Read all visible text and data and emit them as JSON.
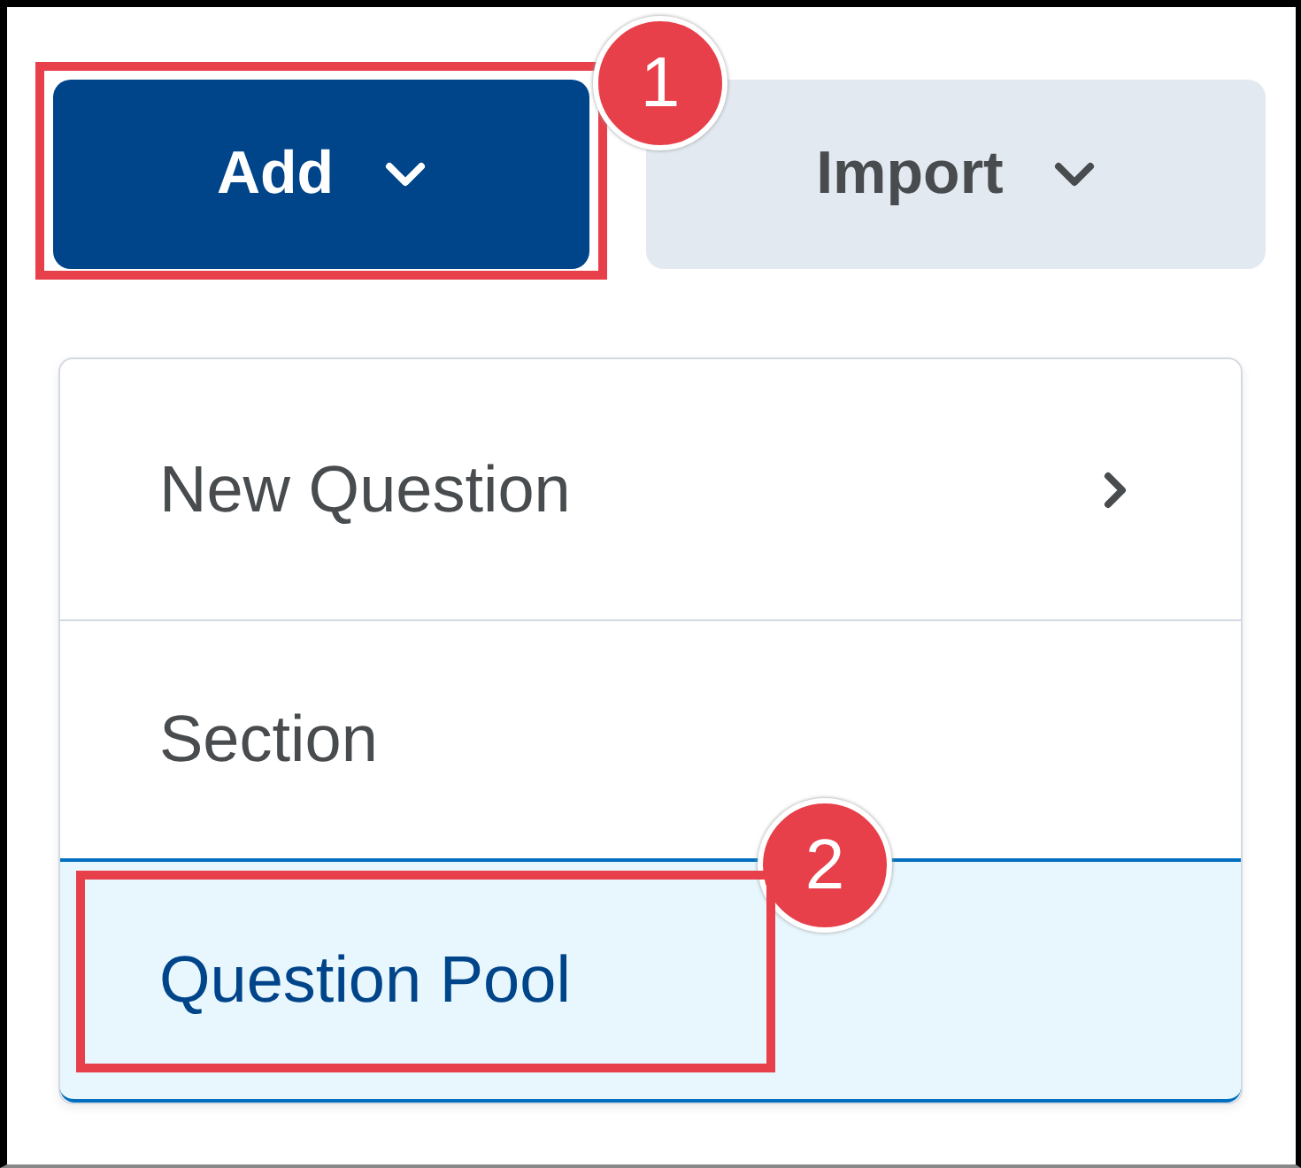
{
  "toolbar": [
    {
      "label": "Add",
      "kind": "primary",
      "callout": "1"
    },
    {
      "label": "Import",
      "kind": "secondary"
    }
  ],
  "menu": {
    "items": [
      {
        "label": "New Question",
        "submenu": true,
        "selected": false
      },
      {
        "label": "Section",
        "submenu": false,
        "selected": false
      },
      {
        "label": "Question Pool",
        "submenu": false,
        "selected": true,
        "callout": "2"
      }
    ]
  }
}
